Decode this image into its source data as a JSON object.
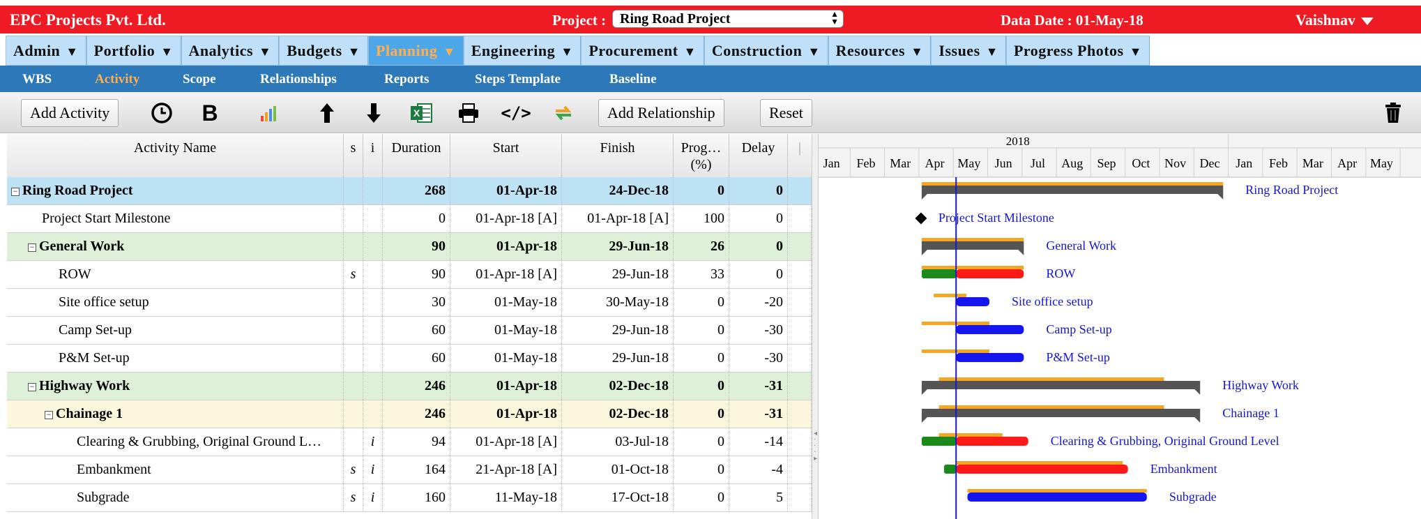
{
  "header": {
    "company": "EPC Projects Pvt. Ltd.",
    "project_label": "Project :",
    "project_value": "Ring Road Project",
    "data_date": "Data Date : 01-May-18",
    "user": "Vaishnav",
    "bar_color": "#ef1b24"
  },
  "main_menu": [
    {
      "label": "Admin",
      "active": false
    },
    {
      "label": "Portfolio",
      "active": false
    },
    {
      "label": "Analytics",
      "active": false
    },
    {
      "label": "Budgets",
      "active": false
    },
    {
      "label": "Planning",
      "active": true
    },
    {
      "label": "Engineering",
      "active": false
    },
    {
      "label": "Procurement",
      "active": false
    },
    {
      "label": "Construction",
      "active": false
    },
    {
      "label": "Resources",
      "active": false
    },
    {
      "label": "Issues",
      "active": false
    },
    {
      "label": "Progress Photos",
      "active": false
    }
  ],
  "sub_menu": [
    {
      "label": "WBS",
      "active": false
    },
    {
      "label": "Activity",
      "active": true
    },
    {
      "label": "Scope",
      "active": false
    },
    {
      "label": "Relationships",
      "active": false
    },
    {
      "label": "Reports",
      "active": false
    },
    {
      "label": "Steps Template",
      "active": false
    },
    {
      "label": "Baseline",
      "active": false
    }
  ],
  "toolbar": {
    "add_activity": "Add Activity",
    "add_relationship": "Add Relationship",
    "reset": "Reset",
    "icons": [
      "clock-icon",
      "bold-icon",
      "chart-icon",
      "move-up-icon",
      "move-down-icon",
      "excel-icon",
      "print-icon",
      "code-icon",
      "sync-icon",
      "trash-icon"
    ]
  },
  "grid": {
    "columns": {
      "name": "Activity Name",
      "s": "s",
      "i": "i",
      "duration": "Duration",
      "start": "Start",
      "finish": "Finish",
      "progress": "Prog…",
      "progress_unit": "(%)",
      "delay": "Delay"
    },
    "rows": [
      {
        "name": "Ring Road Project",
        "s": "",
        "i": "",
        "duration": "268",
        "start": "01-Apr-18",
        "finish": "24-Dec-18",
        "progress": "0",
        "delay": "0",
        "kind": "project"
      },
      {
        "name": "Project Start Milestone",
        "s": "",
        "i": "",
        "duration": "0",
        "start": "01-Apr-18 [A]",
        "finish": "01-Apr-18 [A]",
        "progress": "100",
        "delay": "0",
        "kind": "task1"
      },
      {
        "name": "General Work",
        "s": "",
        "i": "",
        "duration": "90",
        "start": "01-Apr-18",
        "finish": "29-Jun-18",
        "progress": "26",
        "delay": "0",
        "kind": "wbs1"
      },
      {
        "name": "ROW",
        "s": "s",
        "i": "",
        "duration": "90",
        "start": "01-Apr-18 [A]",
        "finish": "29-Jun-18",
        "progress": "33",
        "delay": "0",
        "kind": "task2"
      },
      {
        "name": "Site office setup",
        "s": "",
        "i": "",
        "duration": "30",
        "start": "01-May-18",
        "finish": "30-May-18",
        "progress": "0",
        "delay": "-20",
        "kind": "task2"
      },
      {
        "name": "Camp Set-up",
        "s": "",
        "i": "",
        "duration": "60",
        "start": "01-May-18",
        "finish": "29-Jun-18",
        "progress": "0",
        "delay": "-30",
        "kind": "task2"
      },
      {
        "name": "P&M Set-up",
        "s": "",
        "i": "",
        "duration": "60",
        "start": "01-May-18",
        "finish": "29-Jun-18",
        "progress": "0",
        "delay": "-30",
        "kind": "task2"
      },
      {
        "name": "Highway Work",
        "s": "",
        "i": "",
        "duration": "246",
        "start": "01-Apr-18",
        "finish": "02-Dec-18",
        "progress": "0",
        "delay": "-31",
        "kind": "wbs1"
      },
      {
        "name": "Chainage 1",
        "s": "",
        "i": "",
        "duration": "246",
        "start": "01-Apr-18",
        "finish": "02-Dec-18",
        "progress": "0",
        "delay": "-31",
        "kind": "wbs2"
      },
      {
        "name": "Clearing & Grubbing, Original Ground L…",
        "s": "",
        "i": "i",
        "duration": "94",
        "start": "01-Apr-18 [A]",
        "finish": "03-Jul-18",
        "progress": "0",
        "delay": "-14",
        "kind": "task3"
      },
      {
        "name": "Embankment",
        "s": "s",
        "i": "i",
        "duration": "164",
        "start": "21-Apr-18 [A]",
        "finish": "01-Oct-18",
        "progress": "0",
        "delay": "-4",
        "kind": "task3"
      },
      {
        "name": "Subgrade",
        "s": "s",
        "i": "i",
        "duration": "160",
        "start": "11-May-18",
        "finish": "17-Oct-18",
        "progress": "0",
        "delay": "5",
        "kind": "task3"
      }
    ]
  },
  "gantt": {
    "year_label": "2018",
    "months": [
      "Jan",
      "Feb",
      "Mar",
      "Apr",
      "May",
      "Jun",
      "Jul",
      "Aug",
      "Sep",
      "Oct",
      "Nov",
      "Dec",
      "Jan",
      "Feb",
      "Mar",
      "Apr",
      "May"
    ],
    "data_date_month": 4.0,
    "colors": {
      "summary": "#555555",
      "baseline": "#f5a623",
      "actual": "#1a8a1a",
      "critical": "#ff1a1a",
      "planned": "#1515f0",
      "label": "#1515d0",
      "dataline": "#1a1acc"
    },
    "bars": [
      {
        "label": "Ring Road Project",
        "type": "summary",
        "start": 3.0,
        "end": 11.77,
        "base_start": 3.0,
        "base_end": 11.77
      },
      {
        "label": "Project Start Milestone",
        "type": "milestone",
        "start": 3.0
      },
      {
        "label": "General Work",
        "type": "summary",
        "start": 3.0,
        "end": 5.97,
        "base_start": 3.0,
        "base_end": 5.97
      },
      {
        "label": "ROW",
        "type": "task",
        "start": 3.0,
        "actual_end": 4.0,
        "end": 5.97,
        "critical": true,
        "base_start": 3.0,
        "base_end": 5.97
      },
      {
        "label": "Site office setup",
        "type": "task",
        "start": 4.0,
        "end": 4.97,
        "critical": false,
        "base_start": 3.35,
        "base_end": 4.3
      },
      {
        "label": "Camp Set-up",
        "type": "task",
        "start": 4.0,
        "end": 5.97,
        "critical": false,
        "base_start": 3.0,
        "base_end": 4.97
      },
      {
        "label": "P&M Set-up",
        "type": "task",
        "start": 4.0,
        "end": 5.97,
        "critical": false,
        "base_start": 3.0,
        "base_end": 4.97
      },
      {
        "label": "Highway Work",
        "type": "summary",
        "start": 3.0,
        "end": 11.1,
        "base_start": 3.5,
        "base_end": 10.05
      },
      {
        "label": "Chainage 1",
        "type": "summary",
        "start": 3.0,
        "end": 11.1,
        "base_start": 3.5,
        "base_end": 10.05
      },
      {
        "label": "Clearing & Grubbing, Original Ground Level",
        "type": "task",
        "start": 3.0,
        "actual_end": 4.0,
        "end": 6.1,
        "critical": true,
        "base_start": 3.5,
        "base_end": 5.35
      },
      {
        "label": "Embankment",
        "type": "task",
        "start": 3.65,
        "actual_end": 4.0,
        "end": 9.0,
        "critical": true,
        "base_start": 4.0,
        "base_end": 8.85
      },
      {
        "label": "Subgrade",
        "type": "task",
        "start": 4.33,
        "end": 9.55,
        "critical": false,
        "base_start": 4.33,
        "base_end": 9.55
      }
    ]
  }
}
